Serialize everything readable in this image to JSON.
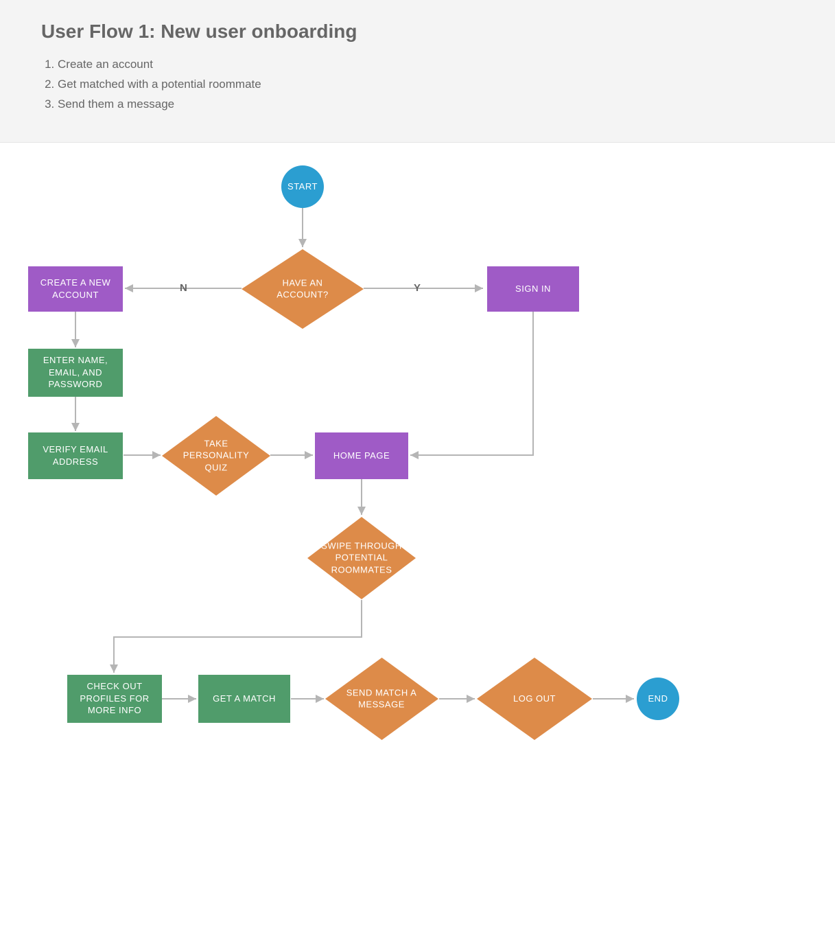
{
  "header": {
    "title": "User Flow 1: New user onboarding",
    "steps": [
      "Create an account",
      "Get matched with a potential roommate",
      "Send them a message"
    ]
  },
  "nodes": {
    "start": "START",
    "have_account": "HAVE AN ACCOUNT?",
    "sign_in": "SIGN IN",
    "create_new_account": "CREATE A NEW ACCOUNT",
    "enter_name_email_pw": "ENTER NAME, EMAIL, AND PASSWORD",
    "verify_email": "VERIFY EMAIL ADDRESS",
    "take_quiz": "TAKE PERSONALITY QUIZ",
    "home_page": "HOME PAGE",
    "swipe_roommates": "SWIPE THROUGH POTENTIAL ROOMMATES",
    "check_profiles": "CHECK OUT PROFILES FOR MORE INFO",
    "get_match": "GET A MATCH",
    "send_message": "SEND MATCH A MESSAGE",
    "log_out": "LOG OUT",
    "end": "END"
  },
  "edge_labels": {
    "no": "N",
    "yes": "Y"
  }
}
